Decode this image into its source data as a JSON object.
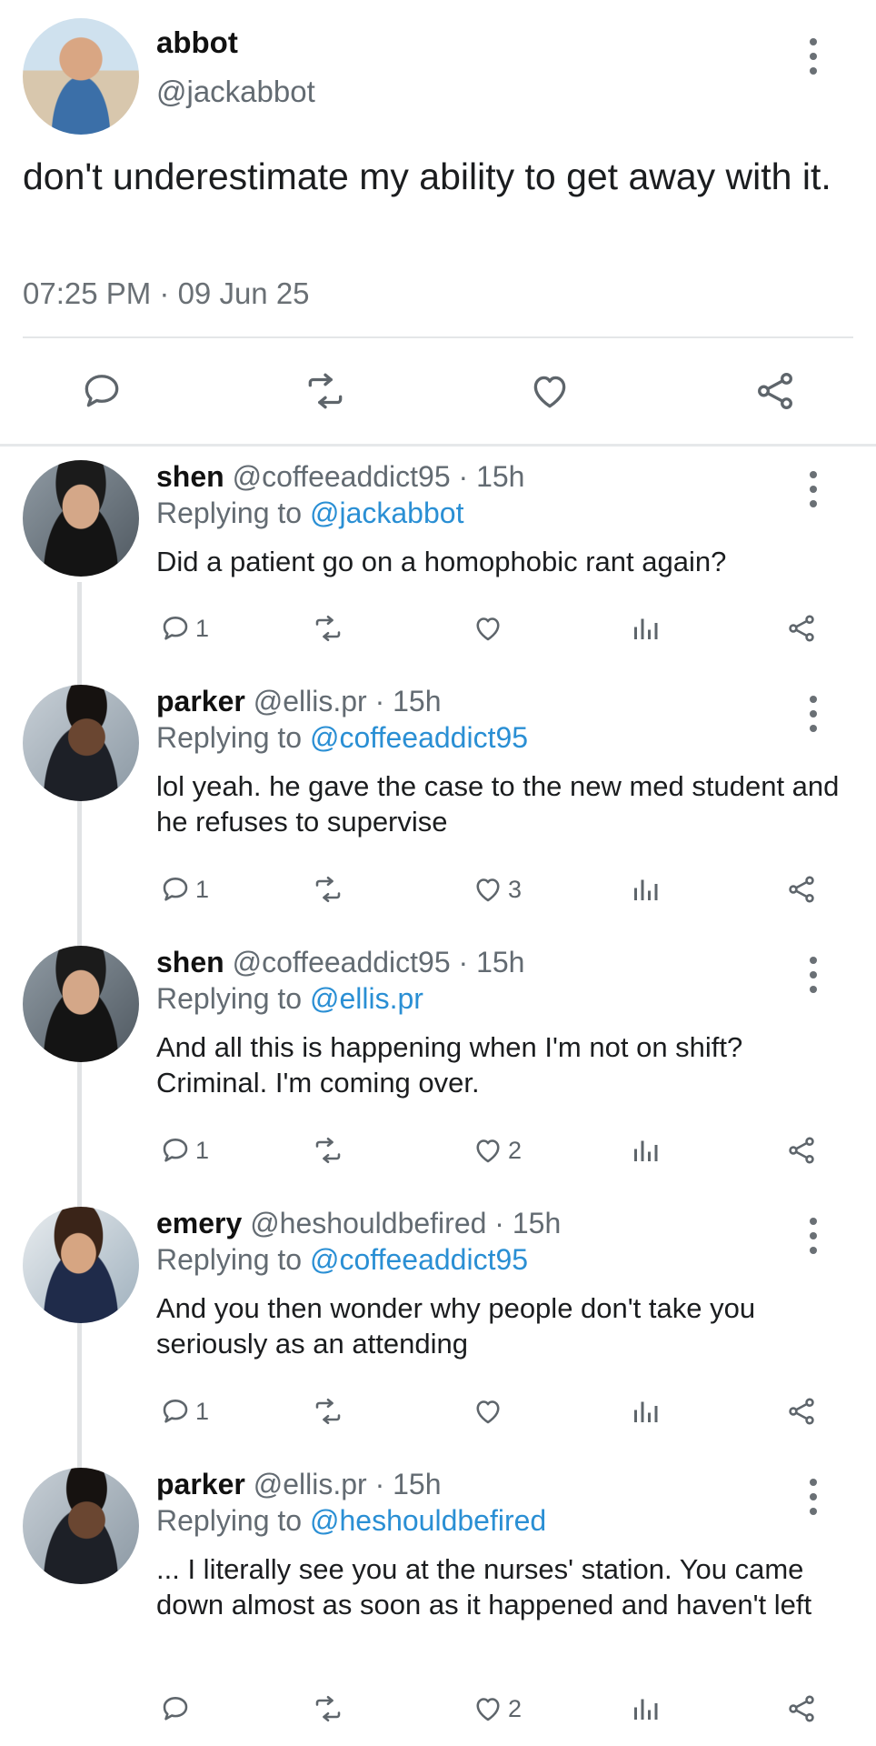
{
  "tweet": {
    "name": "abbot",
    "handle": "@jackabbot",
    "text": "don't underestimate my ability to get away with it.",
    "timestamp": "07:25 PM · 09 Jun 25"
  },
  "replies": [
    {
      "name": "shen",
      "handle": "@coffeeaddict95",
      "time": "· 15h",
      "replying_prefix": "Replying to ",
      "replying_to": "@jackabbot",
      "text": "Did a patient go on a homophobic rant again?",
      "reply_count": "1",
      "like_count": ""
    },
    {
      "name": "parker",
      "handle": "@ellis.pr",
      "time": "· 15h",
      "replying_prefix": "Replying to ",
      "replying_to": "@coffeeaddict95",
      "text": "lol yeah. he gave the case to the new med student and he refuses to supervise",
      "reply_count": "1",
      "like_count": "3"
    },
    {
      "name": "shen",
      "handle": "@coffeeaddict95",
      "time": "· 15h",
      "replying_prefix": "Replying to ",
      "replying_to": "@ellis.pr",
      "text": "And all this is happening when I'm not on shift? Criminal. I'm coming over.",
      "reply_count": "1",
      "like_count": "2"
    },
    {
      "name": "emery",
      "handle": "@heshouldbefired",
      "time": "· 15h",
      "replying_prefix": "Replying to ",
      "replying_to": "@coffeeaddict95",
      "text": "And you then wonder why people don't take you seriously as an attending",
      "reply_count": "1",
      "like_count": ""
    },
    {
      "name": "parker",
      "handle": "@ellis.pr",
      "time": "· 15h",
      "replying_prefix": "Replying to ",
      "replying_to": "@heshouldbefired",
      "text": "... I literally see you at the nurses' station. You came down almost as soon as it happened and haven't left",
      "reply_count": "",
      "like_count": "2"
    }
  ],
  "colors": {
    "link": "#2a8fd4",
    "icon": "#5e656b"
  }
}
